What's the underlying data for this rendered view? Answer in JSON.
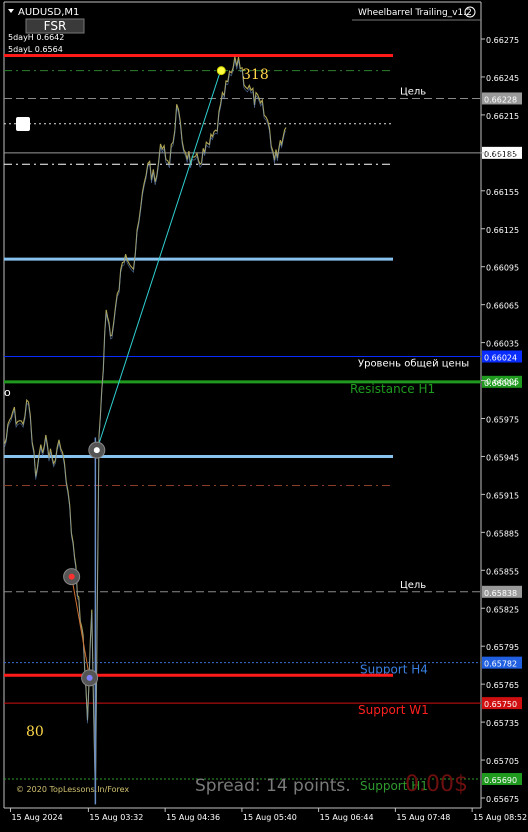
{
  "window": {
    "symbol_title": "AUDUSD,M1",
    "fsr_button": "FSR",
    "expert_title": "Wheelbarrel Trailing_v1.2",
    "smiley": "☺"
  },
  "info": {
    "day_high": "5dayH 0.6642",
    "day_low": "5dayL 0.6564",
    "counter_top": "318",
    "counter_bottom": "80",
    "left_marker": "o"
  },
  "footer": {
    "copyright": "© 2020 TopLessons.In/Forex",
    "spread": "Spread: 14 points.",
    "profit": "0.00$"
  },
  "colors": {
    "background": "#000000",
    "axis": "#c0c0c0",
    "price_line": "#b8ae5a",
    "trend_line": "#30d0d0",
    "resistance_line": "#ff1a1a",
    "level_line": "#87c3ee",
    "support_line": "#ff1a1a",
    "green_level": "#1f9a1f",
    "blue_level": "#0a2dff"
  },
  "chart_data": {
    "type": "line",
    "symbol": "AUDUSD",
    "timeframe": "M1",
    "ylim": [
      0.65658,
      0.6629
    ],
    "y_ticks": [
      "0.66275",
      "0.66245",
      "0.66215",
      "0.66185",
      "0.66155",
      "0.66125",
      "0.66095",
      "0.66065",
      "0.66035",
      "0.66005",
      "0.65975",
      "0.65945",
      "0.65915",
      "0.65885",
      "0.65855",
      "0.65825",
      "0.65795",
      "0.65765",
      "0.65735",
      "0.65705",
      "0.65675"
    ],
    "x_ticks": [
      "15 Aug 2024",
      "15 Aug 03:32",
      "15 Aug 04:36",
      "15 Aug 05:40",
      "15 Aug 06:44",
      "15 Aug 07:48",
      "15 Aug 08:52"
    ],
    "x_tick_times": [
      2.45,
      3.533,
      4.6,
      5.667,
      6.733,
      7.8,
      8.867
    ],
    "xlim": [
      2.36,
      8.99
    ],
    "price_path": [
      [
        2.37,
        0.65955
      ],
      [
        2.48,
        0.6598
      ],
      [
        2.6,
        0.6597
      ],
      [
        2.7,
        0.65988
      ],
      [
        2.8,
        0.6593
      ],
      [
        2.92,
        0.6596
      ],
      [
        3.05,
        0.6594
      ],
      [
        3.15,
        0.65958
      ],
      [
        3.25,
        0.65915
      ],
      [
        3.32,
        0.65875
      ],
      [
        3.4,
        0.6583
      ],
      [
        3.46,
        0.658
      ],
      [
        3.52,
        0.6574
      ],
      [
        3.58,
        0.6582
      ],
      [
        3.63,
        0.6567
      ],
      [
        3.68,
        0.6596
      ],
      [
        3.72,
        0.66
      ],
      [
        3.78,
        0.6606
      ],
      [
        3.86,
        0.6604
      ],
      [
        3.96,
        0.6608
      ],
      [
        4.05,
        0.6611
      ],
      [
        4.16,
        0.66095
      ],
      [
        4.26,
        0.6614
      ],
      [
        4.36,
        0.6618
      ],
      [
        4.46,
        0.6616
      ],
      [
        4.56,
        0.66195
      ],
      [
        4.66,
        0.66175
      ],
      [
        4.76,
        0.6622
      ],
      [
        4.86,
        0.6619
      ],
      [
        5.0,
        0.66175
      ],
      [
        5.15,
        0.66185
      ],
      [
        5.3,
        0.662
      ],
      [
        5.42,
        0.66232
      ],
      [
        5.52,
        0.66248
      ],
      [
        5.62,
        0.6626
      ],
      [
        5.72,
        0.6624
      ],
      [
        5.82,
        0.6623
      ],
      [
        5.95,
        0.6622
      ],
      [
        6.05,
        0.66205
      ],
      [
        6.12,
        0.66178
      ],
      [
        6.2,
        0.66195
      ],
      [
        6.28,
        0.66205
      ]
    ],
    "trend_line": {
      "points": [
        [
          3.65,
          0.6595
        ],
        [
          5.37,
          0.6625
        ]
      ],
      "label": "318"
    },
    "entry_markers": [
      {
        "t": 3.3,
        "price": 0.6585
      },
      {
        "t": 3.55,
        "price": 0.6577
      },
      {
        "t": 3.65,
        "price": 0.6595
      },
      {
        "t": 5.38,
        "price": 0.6625
      }
    ],
    "levels": [
      {
        "name": "5dayH",
        "price": 0.66262,
        "style": "solid-red-thick",
        "x_end": 0.745
      },
      {
        "name": "upper-dashdot",
        "price": 0.6625,
        "style": "dashdot-green",
        "x_end": 0.745
      },
      {
        "name": "target-top",
        "price": 0.66228,
        "label": "Цель",
        "tag": "0.66228",
        "style": "dashed-gray"
      },
      {
        "name": "upper-dotted",
        "price": 0.66208,
        "style": "dotted-white",
        "x_end": 0.745
      },
      {
        "name": "current-price",
        "price": 0.66185,
        "tag": "0.66185",
        "style": "solid-gray-thin"
      },
      {
        "name": "upper-dashdot-white",
        "price": 0.66176,
        "style": "dashdot-white",
        "x_end": 0.745
      },
      {
        "name": "upper-blue-band",
        "price": 0.66101,
        "style": "solid-lightblue-thick",
        "x_end": 0.745
      },
      {
        "name": "general-price",
        "price": 0.66024,
        "label": "Уровень общей цены",
        "tag": "0.66024",
        "style": "solid-blue"
      },
      {
        "name": "resistance-h1",
        "price": 0.66004,
        "label": "Resistance H1",
        "tag": "0.66004",
        "style": "solid-green-thick"
      },
      {
        "name": "lower-blue-band",
        "price": 0.65945,
        "style": "solid-lightblue-thick",
        "x_end": 0.745
      },
      {
        "name": "lower-dashdot-brown",
        "price": 0.65922,
        "style": "dashdot-brown",
        "x_end": 0.745
      },
      {
        "name": "target-bottom",
        "price": 0.65838,
        "label": "Цель",
        "tag": "0.65838",
        "style": "dashed-gray"
      },
      {
        "name": "support-h4",
        "price": 0.65782,
        "label": "Support H4",
        "tag": "0.65782",
        "style": "dotted-blue"
      },
      {
        "name": "lower-red-thick",
        "price": 0.65772,
        "style": "solid-red-thick",
        "x_end": 0.745
      },
      {
        "name": "support-w1",
        "price": 0.6575,
        "label": "Support W1",
        "tag": "0.65750",
        "style": "solid-red-thin"
      },
      {
        "name": "support-h1",
        "price": 0.6569,
        "label": "Support H1",
        "tag": "0.65690",
        "style": "dotted-green"
      }
    ]
  }
}
